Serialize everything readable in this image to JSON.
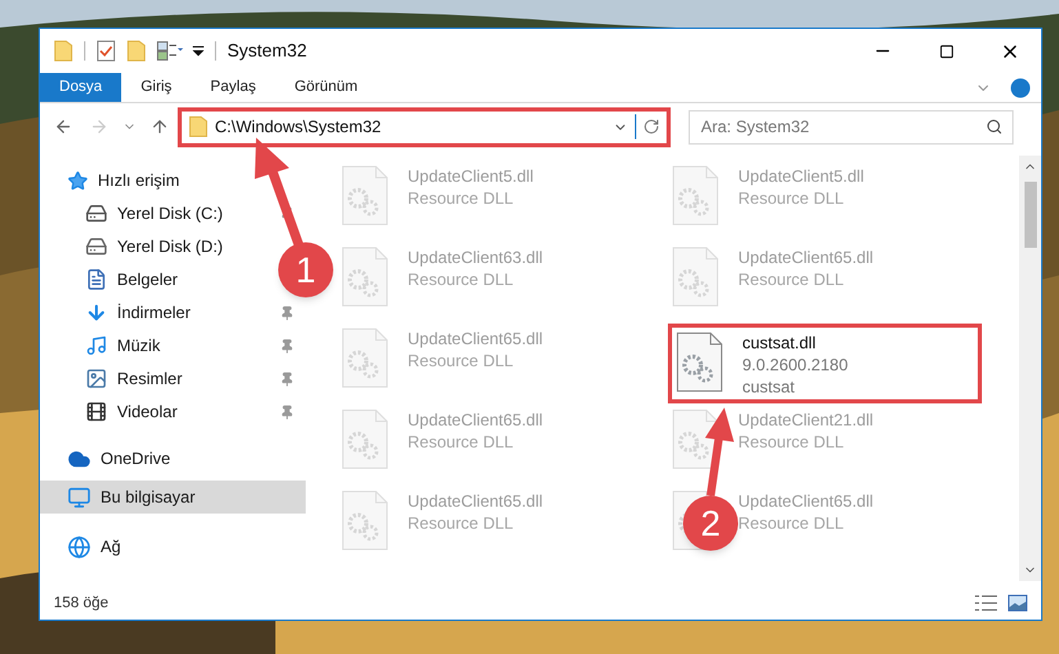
{
  "window": {
    "title": "System32"
  },
  "ribbon_tabs": [
    {
      "label": "Dosya",
      "selected": true
    },
    {
      "label": "Giriş",
      "selected": false
    },
    {
      "label": "Paylaş",
      "selected": false
    },
    {
      "label": "Görünüm",
      "selected": false
    }
  ],
  "address": {
    "path": "C:\\Windows\\System32",
    "highlighted": true
  },
  "search": {
    "placeholder": "Ara: System32"
  },
  "sidebar": {
    "items": [
      {
        "label": "Hızlı erişim",
        "kind": "quick",
        "selected": false,
        "children": [
          {
            "label": "Yerel Disk (C:)",
            "kind": "drive-c",
            "pinned": true
          },
          {
            "label": "Yerel Disk (D:)",
            "kind": "drive",
            "pinned": false
          },
          {
            "label": "Belgeler",
            "kind": "documents",
            "pinned": false
          },
          {
            "label": "İndirmeler",
            "kind": "downloads",
            "pinned": true
          },
          {
            "label": "Müzik",
            "kind": "music",
            "pinned": true
          },
          {
            "label": "Resimler",
            "kind": "pictures",
            "pinned": true
          },
          {
            "label": "Videolar",
            "kind": "videos",
            "pinned": true
          }
        ]
      },
      {
        "label": "OneDrive",
        "kind": "cloud",
        "selected": false
      },
      {
        "label": "Bu bilgisayar",
        "kind": "computer",
        "selected": true
      },
      {
        "label": "Ağ",
        "kind": "network",
        "selected": false
      }
    ]
  },
  "files": [
    {
      "name": "UpdateClient5.dll",
      "lines": [
        "Resource DLL"
      ],
      "faded": true,
      "highlighted": false
    },
    {
      "name": "UpdateClient5.dll",
      "lines": [
        "Resource DLL"
      ],
      "faded": true,
      "highlighted": false
    },
    {
      "name": "UpdateClient63.dll",
      "lines": [
        "Resource DLL"
      ],
      "faded": true,
      "highlighted": false
    },
    {
      "name": "UpdateClient65.dll",
      "lines": [
        "Resource DLL"
      ],
      "faded": true,
      "highlighted": false
    },
    {
      "name": "UpdateClient65.dll",
      "lines": [
        "Resource DLL"
      ],
      "faded": true,
      "highlighted": false
    },
    {
      "name": "custsat.dll",
      "lines": [
        "9.0.2600.2180",
        "custsat"
      ],
      "faded": false,
      "highlighted": true
    },
    {
      "name": "UpdateClient65.dll",
      "lines": [
        "Resource DLL"
      ],
      "faded": true,
      "highlighted": false
    },
    {
      "name": "UpdateClient21.dll",
      "lines": [
        "Resource DLL"
      ],
      "faded": true,
      "highlighted": false
    },
    {
      "name": "UpdateClient65.dll",
      "lines": [
        "Resource DLL"
      ],
      "faded": true,
      "highlighted": false
    },
    {
      "name": "UpdateClient65.dll",
      "lines": [
        "Resource DLL"
      ],
      "faded": true,
      "highlighted": false
    }
  ],
  "status_bar": {
    "count": "158 öğe"
  },
  "annotations": [
    {
      "label": "1"
    },
    {
      "label": "2"
    }
  ]
}
